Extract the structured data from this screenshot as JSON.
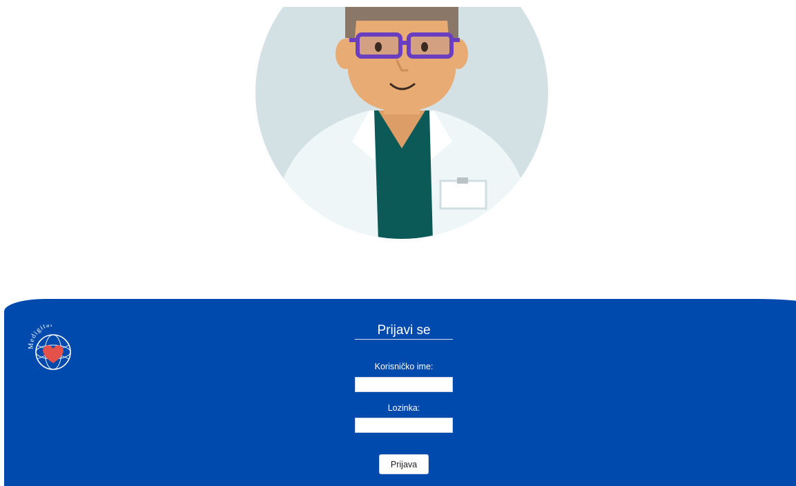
{
  "colors": {
    "panel_background": "#004aad",
    "avatar_circle": "#d4e1e4",
    "skin": "#e8ab73",
    "hair": "#8b7767",
    "glasses": "#6a3fbf",
    "scrubs": "#0b5a57",
    "coat": "#eef6f7",
    "logo_heart": "#e4514b"
  },
  "avatar": {
    "icon": "doctor-avatar-icon"
  },
  "logo": {
    "icon": "medigital-logo-icon",
    "text": "Medigital"
  },
  "login_form": {
    "title": "Prijavi se",
    "username_label": "Korisničko ime:",
    "username_value": "",
    "password_label": "Lozinka:",
    "password_value": "",
    "submit_label": "Prijava"
  }
}
